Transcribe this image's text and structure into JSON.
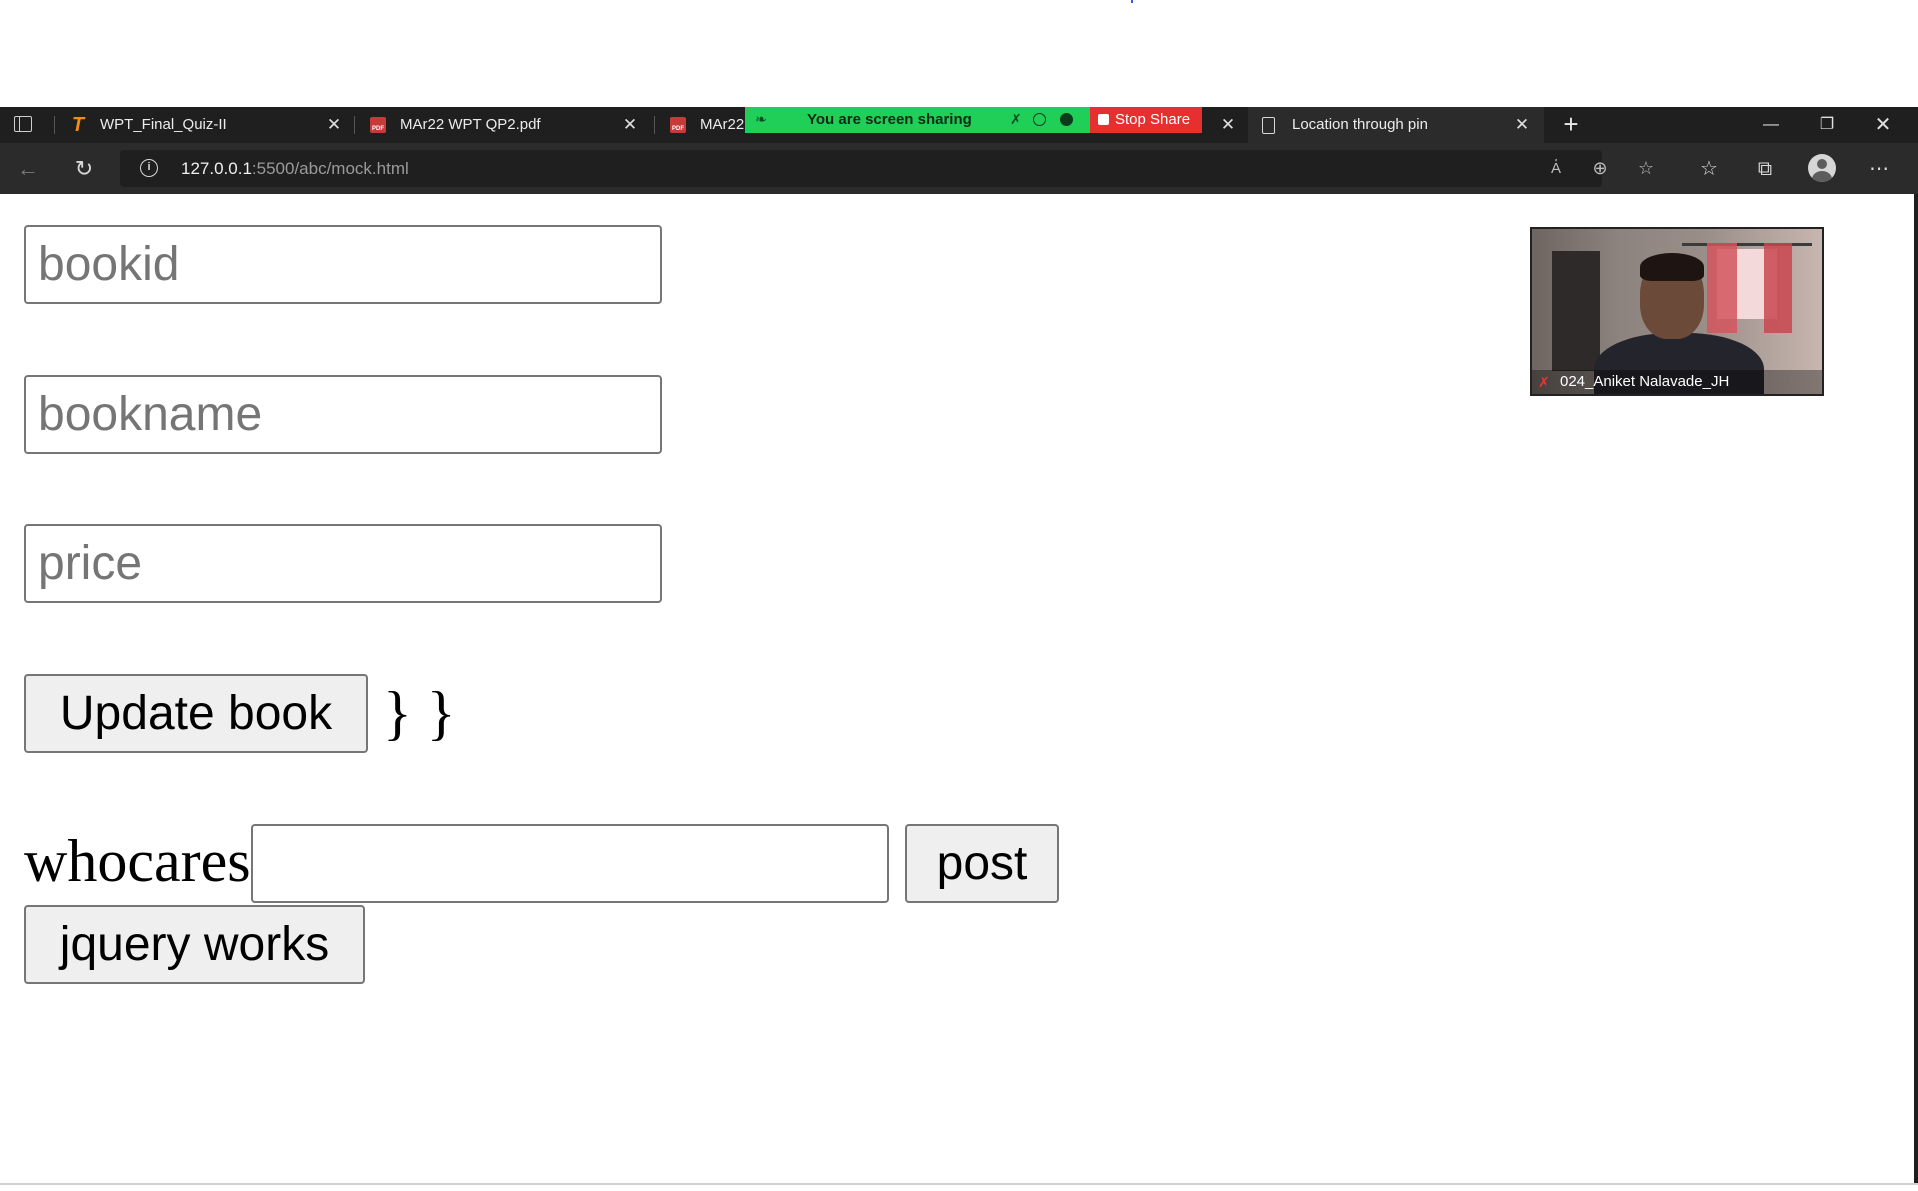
{
  "tabs": [
    {
      "title": "WPT_Final_Quiz-II",
      "icon": "quiz-favicon-icon"
    },
    {
      "title": "MAr22 WPT QP2.pdf",
      "icon": "pdf-icon"
    },
    {
      "title": "MAr22",
      "icon": "pdf-icon"
    },
    {
      "title": "Location through pin",
      "icon": "document-icon",
      "active": true
    }
  ],
  "screen_share": {
    "status_text": "You are screen sharing",
    "stop_label": "Stop Share",
    "color": "#1fcf58",
    "stop_color": "#e5302f"
  },
  "address_bar": {
    "host": "127.0.0.1",
    "path": ":5500/abc/mock.html"
  },
  "form": {
    "bookid_placeholder": "bookid",
    "bookname_placeholder": "bookname",
    "price_placeholder": "price",
    "update_button": "Update book",
    "braces_text": "} }",
    "whocares_label": "whocares",
    "whocares_value": "",
    "post_button": "post",
    "jquery_button": "jquery works"
  },
  "video": {
    "participant_name": "024_Aniket Nalavade_JH",
    "muted": true
  }
}
